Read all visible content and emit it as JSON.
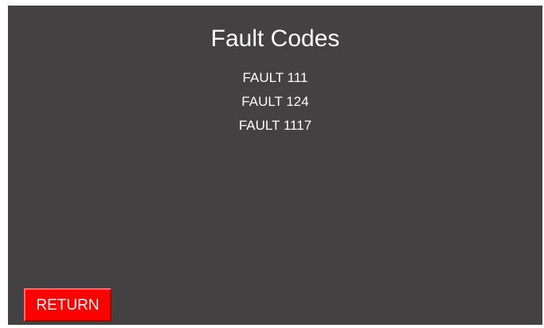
{
  "screen": {
    "title": "Fault Codes",
    "background_color": "#434142",
    "faults": [
      "FAULT 111",
      "FAULT 124",
      "FAULT 1117"
    ]
  },
  "footer": {
    "return_label": "RETURN",
    "return_color": "#ff0000"
  }
}
